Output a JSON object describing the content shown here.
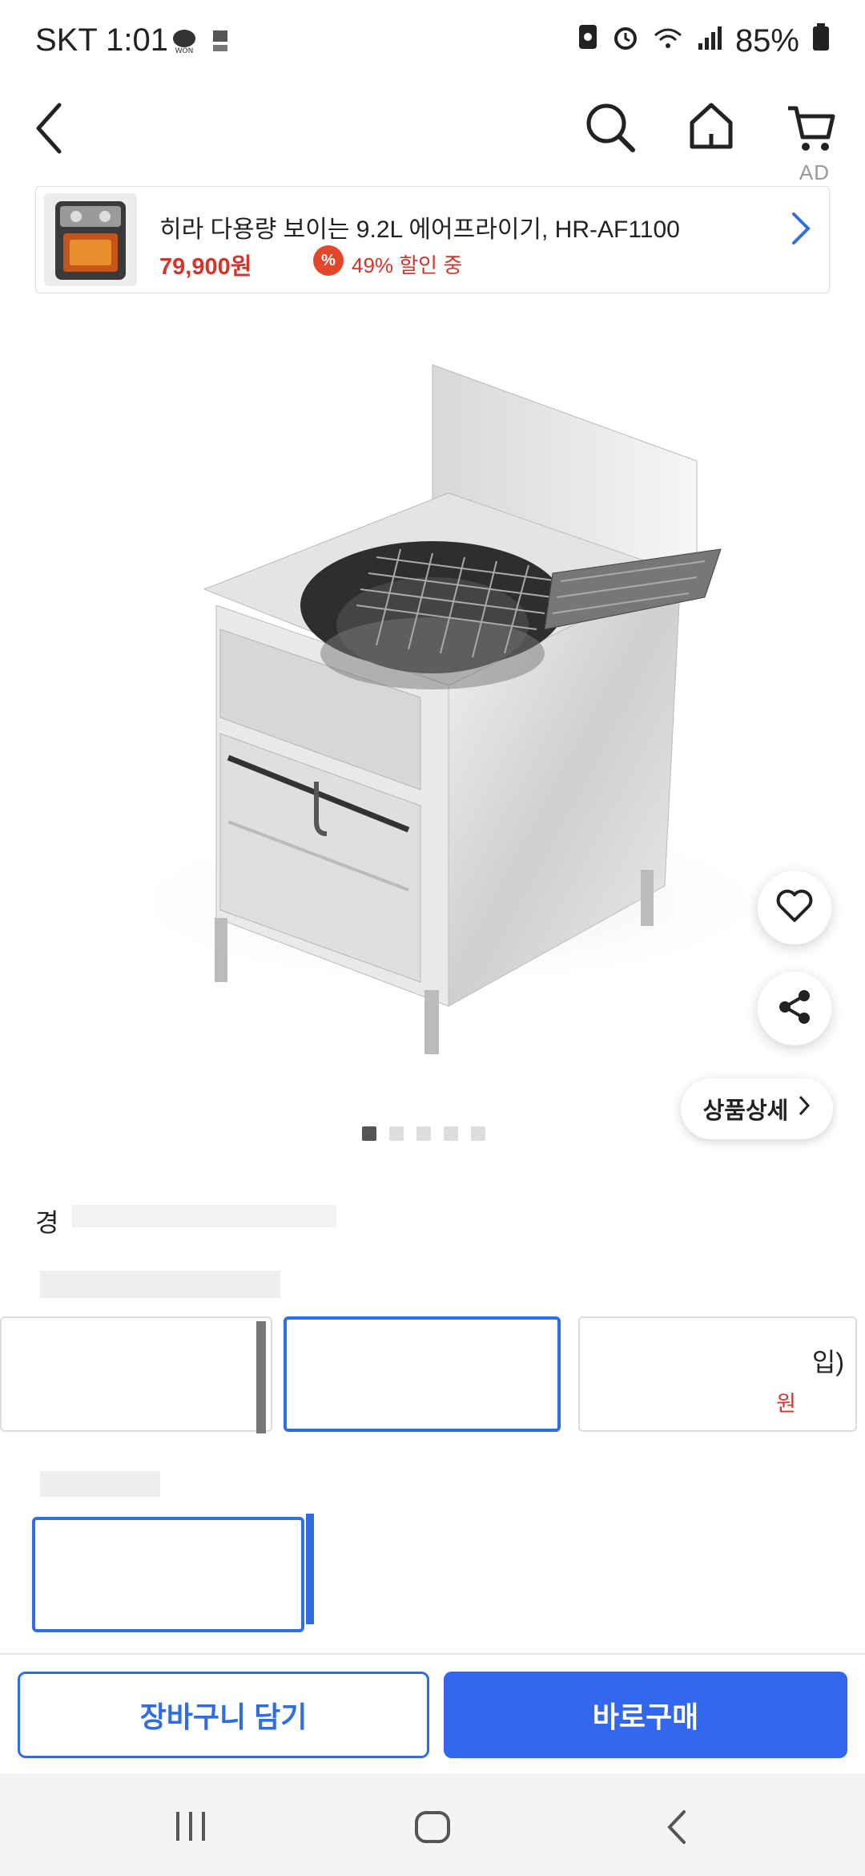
{
  "status_bar": {
    "carrier_time": "SKT 1:01",
    "battery": "85%",
    "icons": [
      "won-notification-icon",
      "bill-notification-icon",
      "nfc-icon",
      "alarm-icon",
      "wifi-icon",
      "signal-icon",
      "battery-icon"
    ]
  },
  "nav": {
    "icons": [
      "back-icon",
      "search-icon",
      "home-icon",
      "cart-icon"
    ]
  },
  "ad": {
    "label": "AD",
    "title": "히라 다용량 보이는 9.2L 에어프라이기, HR-AF1100",
    "price": "79,900원",
    "badge": "%",
    "discount": "49% 할인 중"
  },
  "product": {
    "detail_button": "상품상세",
    "image_count": 5,
    "active_image": 0,
    "brand": "경",
    "option_group_1_title": "",
    "options_1": [
      {
        "name": "",
        "price": ""
      },
      {
        "name": "",
        "price": ""
      },
      {
        "name": "입)",
        "price": "원"
      }
    ],
    "option_group_2_title": "",
    "options_2": [
      {
        "name": "",
        "price": ""
      },
      {
        "name": "",
        "price": ""
      }
    ]
  },
  "actions": {
    "cart_label": "장바구니 담기",
    "buy_label": "바로구매"
  },
  "colors": {
    "accent": "#2f6de5",
    "buy_button": "#3467f0",
    "price_red": "#d6342b"
  }
}
